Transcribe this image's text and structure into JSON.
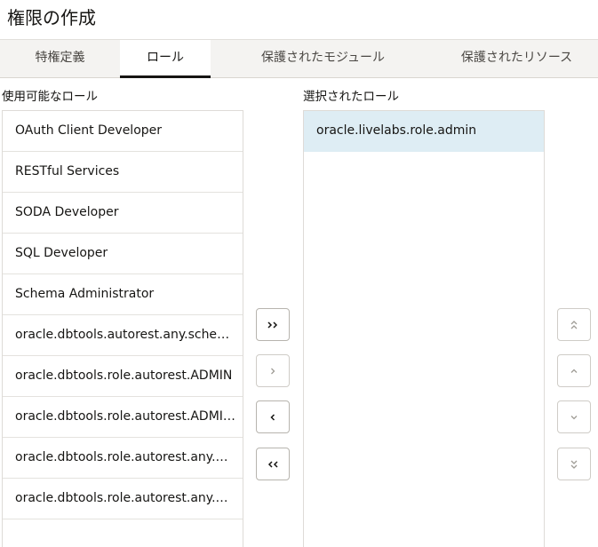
{
  "page": {
    "title": "権限の作成"
  },
  "tabs": [
    {
      "label": "特権定義",
      "active": false
    },
    {
      "label": "ロール",
      "active": true
    },
    {
      "label": "保護されたモジュール",
      "active": false
    },
    {
      "label": "保護されたリソース",
      "active": false
    }
  ],
  "available": {
    "label": "使用可能なロール",
    "items": [
      "OAuth Client Developer",
      "RESTful Services",
      "SODA Developer",
      "SQL Developer",
      "Schema Administrator",
      "oracle.dbtools.autorest.any.schema",
      "oracle.dbtools.role.autorest.ADMIN",
      "oracle.dbtools.role.autorest.ADMIN....",
      "oracle.dbtools.role.autorest.any.AD...",
      "oracle.dbtools.role.autorest.any.OR..."
    ]
  },
  "selected": {
    "label": "選択されたロール",
    "items": [
      "oracle.livelabs.role.admin"
    ]
  },
  "shuttle_buttons": {
    "move_all_right": "move-all-right-icon",
    "move_right": "move-right-icon",
    "move_left": "move-left-icon",
    "move_all_left": "move-all-left-icon"
  },
  "reorder_buttons": {
    "move_top": "move-to-top-icon",
    "move_up": "move-up-icon",
    "move_down": "move-down-icon",
    "move_bottom": "move-to-bottom-icon"
  },
  "colors": {
    "selected_row": "#deedf4",
    "active_tab_underline": "#161513",
    "tabbar_bg": "#f4f3f1"
  }
}
